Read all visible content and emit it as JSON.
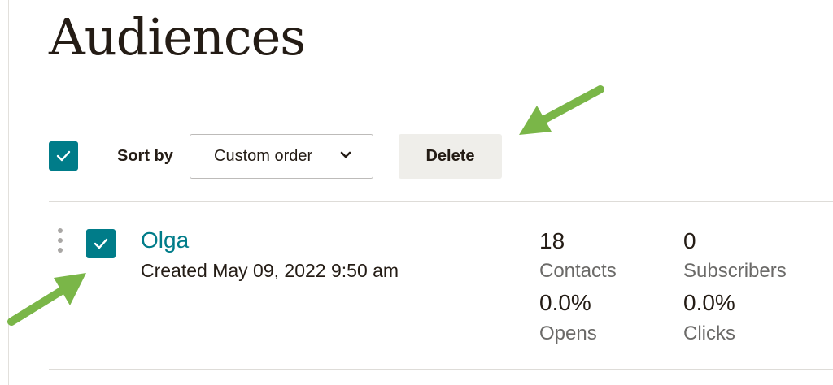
{
  "page": {
    "title": "Audiences"
  },
  "toolbar": {
    "select_all_checked": true,
    "sort_label": "Sort by",
    "sort_value": "Custom order",
    "delete_label": "Delete"
  },
  "audiences": [
    {
      "name": "Olga",
      "created": "Created May 09, 2022 9:50 am",
      "checked": true,
      "contacts_value": "18",
      "contacts_label": "Contacts",
      "subscribers_value": "0",
      "subscribers_label": "Subscribers",
      "opens_value": "0.0%",
      "opens_label": "Opens",
      "clicks_value": "0.0%",
      "clicks_label": "Clicks"
    }
  ],
  "colors": {
    "accent": "#007c89",
    "annotation_arrow": "#7ab648",
    "text": "#241c15",
    "muted_text": "#6b6a68",
    "delete_bg": "#efeeea"
  },
  "icons": {
    "checkbox": "checkmark-icon",
    "sort": "chevron-down-icon",
    "drag": "drag-handle-icon"
  }
}
